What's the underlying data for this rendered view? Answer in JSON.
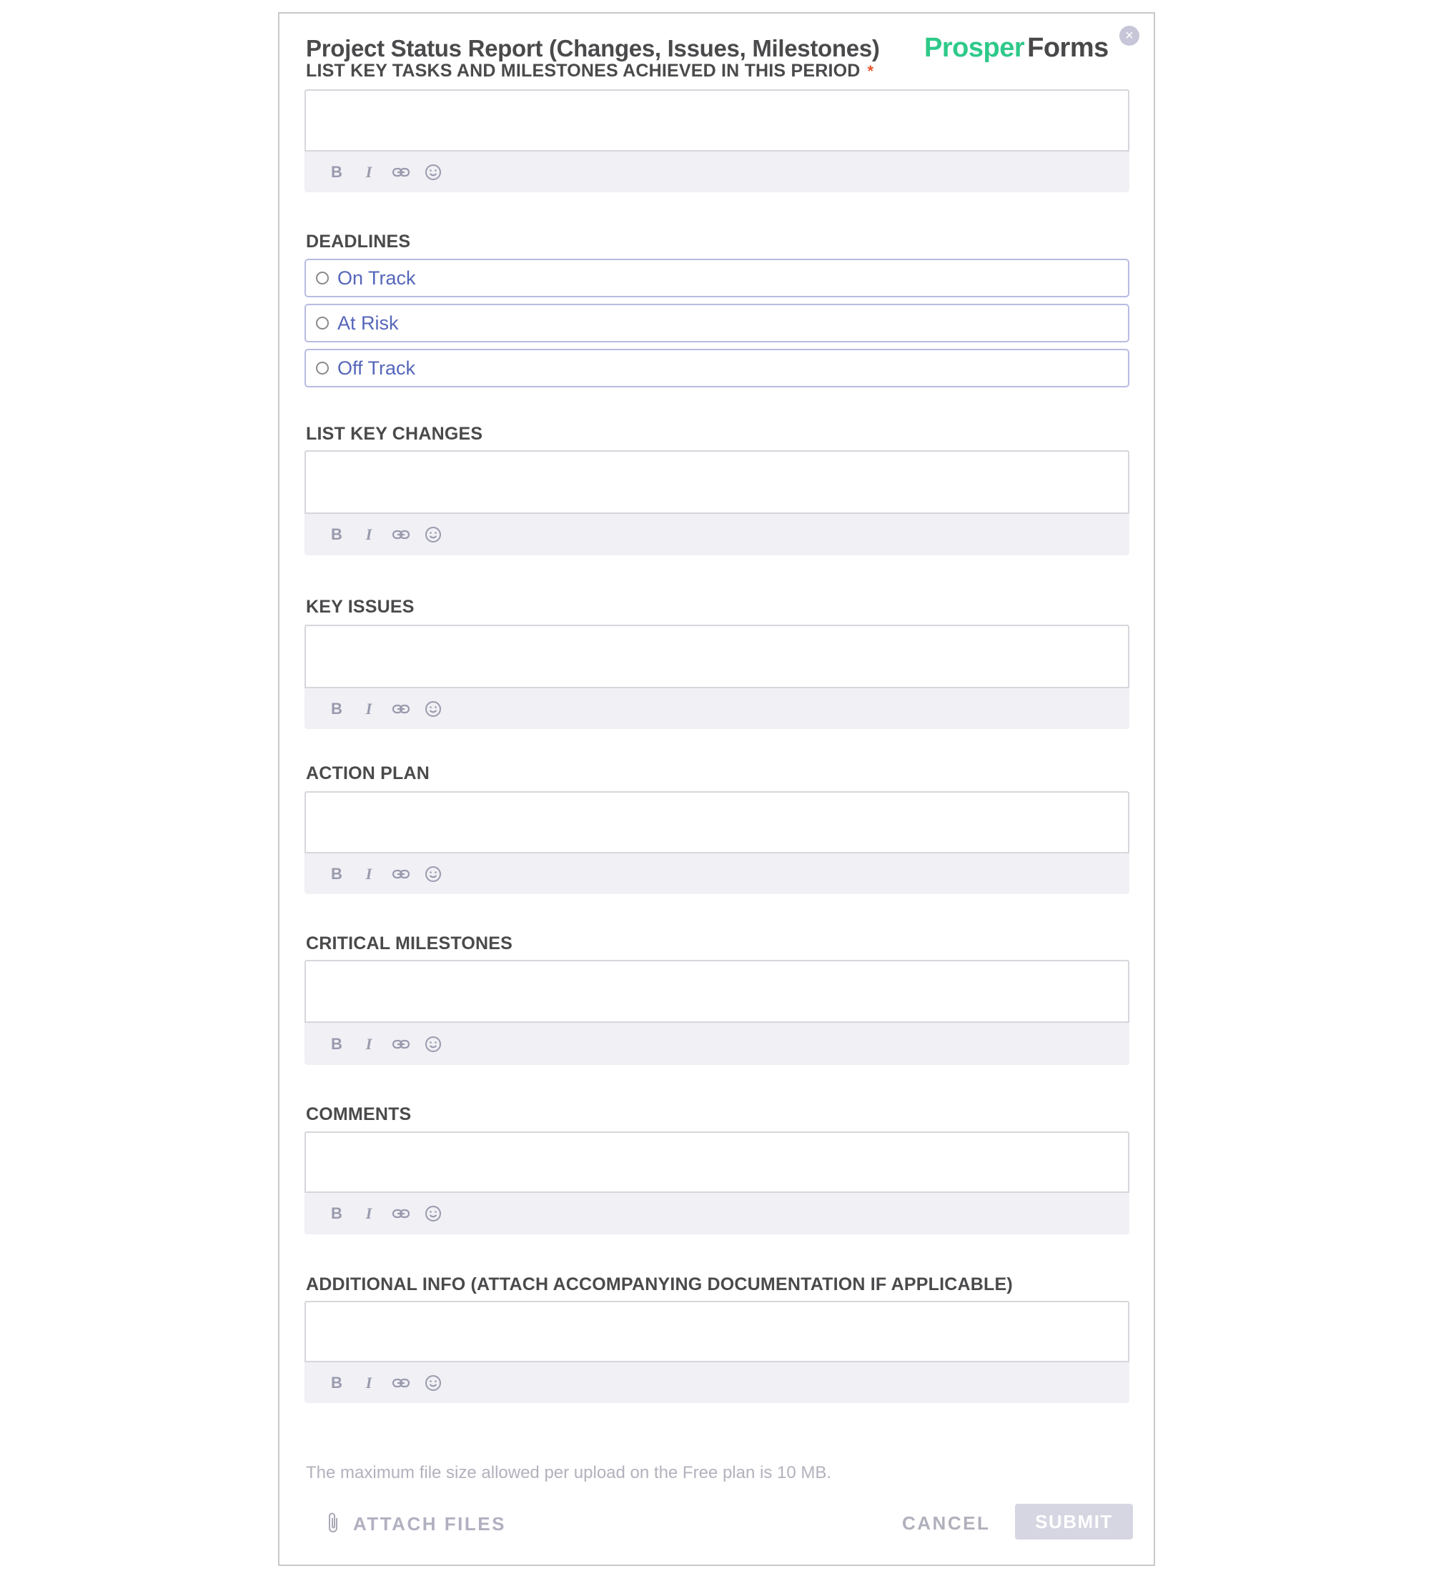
{
  "form": {
    "title": "Project Status Report (Changes, Issues, Milestones)",
    "close_icon": "×"
  },
  "brand": {
    "part1": "Prosper",
    "part2": "Forms",
    "color_primary": "#2ec98a",
    "color_secondary": "#48484a"
  },
  "fields": [
    {
      "label": "LIST KEY TASKS AND MILESTONES ACHIEVED IN THIS PERIOD",
      "required": true,
      "required_mark": "*",
      "value": ""
    },
    {
      "label": "LIST KEY CHANGES",
      "value": ""
    },
    {
      "label": "KEY ISSUES",
      "value": ""
    },
    {
      "label": "ACTION PLAN",
      "value": ""
    },
    {
      "label": "CRITICAL MILESTONES",
      "value": ""
    },
    {
      "label": "COMMENTS",
      "value": ""
    },
    {
      "label": "ADDITIONAL INFO (ATTACH ACCOMPANYING DOCUMENTATION IF APPLICABLE)",
      "value": ""
    }
  ],
  "toolbar": {
    "bold": "B",
    "italic": "I",
    "link_icon": "link-icon",
    "emoji_icon": "smiley-icon"
  },
  "deadlines": {
    "label": "DEADLINES",
    "options": [
      "On Track",
      "At Risk",
      "Off Track"
    ],
    "selected": null
  },
  "footer": {
    "note": "The maximum file size allowed per upload on the Free plan is 10 MB.",
    "attach_label": "ATTACH FILES",
    "cancel_label": "CANCEL",
    "submit_label": "SUBMIT"
  },
  "colors": {
    "required": "#e8552a",
    "radio_text": "#5566bb",
    "radio_border": "#b8bbe2",
    "submit_bg": "#d6d6e2"
  }
}
